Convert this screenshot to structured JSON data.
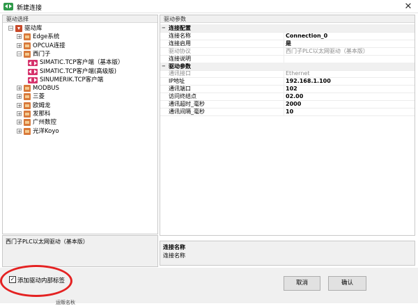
{
  "window": {
    "title": "新建连接",
    "close_glyph": "✕"
  },
  "left_panel": {
    "header": "驱动选择",
    "tree": [
      {
        "label": "驱动库",
        "level": 0,
        "icon": "root-folder-icon",
        "expander": "−"
      },
      {
        "label": "Edge系统",
        "level": 1,
        "icon": "folder-icon",
        "expander": "+"
      },
      {
        "label": "OPCUA连接",
        "level": 1,
        "icon": "folder-icon",
        "expander": "+"
      },
      {
        "label": "西门子",
        "level": 1,
        "icon": "folder-icon",
        "expander": "−"
      },
      {
        "label": "SIMATIC.TCP客户端（基本版）",
        "level": 2,
        "icon": "driver-icon",
        "expander": ""
      },
      {
        "label": "SIMATIC.TCP客户端(高级版)",
        "level": 2,
        "icon": "driver-icon",
        "expander": ""
      },
      {
        "label": "SINUMERIK.TCP客户端",
        "level": 2,
        "icon": "driver-icon",
        "expander": ""
      },
      {
        "label": "MODBUS",
        "level": 1,
        "icon": "folder-icon",
        "expander": "+"
      },
      {
        "label": "三菱",
        "level": 1,
        "icon": "folder-icon",
        "expander": "+"
      },
      {
        "label": "欧姆龙",
        "level": 1,
        "icon": "folder-icon",
        "expander": "+"
      },
      {
        "label": "发那科",
        "level": 1,
        "icon": "folder-icon",
        "expander": "+"
      },
      {
        "label": "广州数控",
        "level": 1,
        "icon": "folder-icon",
        "expander": "+"
      },
      {
        "label": "光洋Koyo",
        "level": 1,
        "icon": "folder-icon",
        "expander": "+"
      }
    ],
    "description": "西门子PLC以太网驱动（基本版）"
  },
  "right_panel": {
    "header": "驱动参数",
    "rows": [
      {
        "type": "category",
        "key": "连接配置",
        "toggle": "−"
      },
      {
        "type": "prop",
        "key": "连接名称",
        "value": "Connection_0",
        "dim": false,
        "bold": true
      },
      {
        "type": "prop",
        "key": "连接启用",
        "value": "是",
        "dim": false,
        "bold": true
      },
      {
        "type": "prop",
        "key": "驱动协议",
        "value": "西门子PLC以太网驱动（基本版）",
        "dim": true,
        "bold": false
      },
      {
        "type": "prop",
        "key": "连接说明",
        "value": "",
        "dim": false,
        "bold": false
      },
      {
        "type": "category",
        "key": "驱动参数",
        "toggle": "−"
      },
      {
        "type": "prop",
        "key": "通讯接口",
        "value": "Ethernet",
        "dim": true,
        "bold": false
      },
      {
        "type": "prop",
        "key": "IP地址",
        "value": "192.168.1.100",
        "dim": false,
        "bold": true
      },
      {
        "type": "prop",
        "key": "通讯端口",
        "value": "102",
        "dim": false,
        "bold": true
      },
      {
        "type": "prop",
        "key": "访问终结点",
        "value": "02.00",
        "dim": false,
        "bold": true
      },
      {
        "type": "prop",
        "key": "通讯超时_毫秒",
        "value": "2000",
        "dim": false,
        "bold": true
      },
      {
        "type": "prop",
        "key": "通讯间隔_毫秒",
        "value": "10",
        "dim": false,
        "bold": true
      }
    ],
    "description": {
      "title": "连接名称",
      "text": "连接名称"
    }
  },
  "bottom": {
    "checkbox_label": "添加驱动内部标签",
    "checkbox_checked": true,
    "checkbox_glyph": "✓",
    "cancel_label": "取消",
    "ok_label": "确认",
    "fragment_text": "运贩名秋"
  },
  "colors": {
    "highlight": "#e42222",
    "accent": "#2f9a4a",
    "driver_icon": "#d6336c",
    "folder_icon": "#d8793a"
  }
}
